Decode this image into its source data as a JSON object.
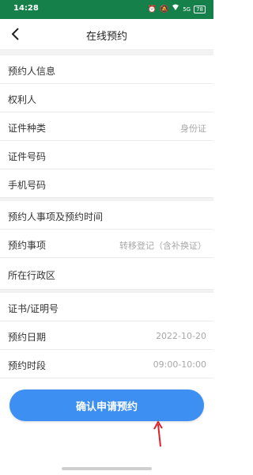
{
  "status_bar": {
    "time": "14:28",
    "sim_label": "5G",
    "battery": "78",
    "bg_color": "#16804a"
  },
  "nav": {
    "title": "在线预约",
    "back_icon": "chevron-left-icon"
  },
  "form": {
    "applicant_section": "预约人信息",
    "owner_label": "权利人",
    "id_type_label": "证件种类",
    "id_type_value": "身份证",
    "id_number_label": "证件号码",
    "phone_label": "手机号码",
    "appointment_section": "预约人事项及预约时间",
    "matter_label": "预约事项",
    "matter_value": "转移登记（含补换证）",
    "district_label": "所在行政区",
    "cert_label": "证书/证明号",
    "date_label": "预约日期",
    "date_value": "2022-10-20",
    "period_label": "预约时段",
    "period_value": "09:00-10:00"
  },
  "submit": {
    "label": "确认申请预约",
    "color": "#3d8ff2"
  },
  "annotation": {
    "arrow_color": "#e0202a"
  }
}
